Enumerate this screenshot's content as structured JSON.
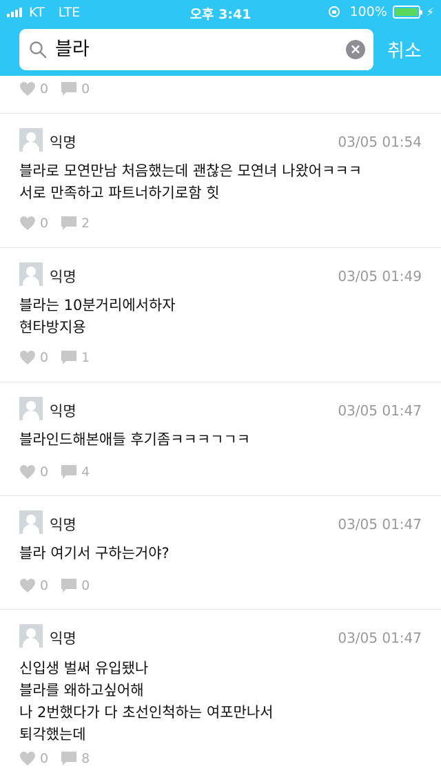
{
  "status_bar": {
    "carrier": "KT",
    "network": "LTE",
    "time": "오후 3:41",
    "battery": "100%",
    "battery_level": 1.0
  },
  "search": {
    "query": "블라",
    "cancel_label": "취소"
  },
  "icons": {
    "like": "heart-icon",
    "comment": "comment-bubble-icon",
    "search": "search-icon",
    "clear": "clear-icon"
  },
  "colors": {
    "header": "#2ec7f5",
    "meta_text": "#9a9a9a",
    "icon_gray": "#c8c8c8"
  },
  "top_partial": {
    "likes": "0",
    "comments": "0"
  },
  "posts": [
    {
      "author": "익명",
      "time": "03/05 01:54",
      "lines": [
        "블라로 모연만남 처음했는데 괜찮은 모연녀 나왔어ㅋㅋㅋ",
        "서로 만족하고 파트너하기로함 힛"
      ],
      "likes": "0",
      "comments": "2"
    },
    {
      "author": "익명",
      "time": "03/05 01:49",
      "lines": [
        "블라는 10분거리에서하자",
        "현타방지용"
      ],
      "likes": "0",
      "comments": "1"
    },
    {
      "author": "익명",
      "time": "03/05 01:47",
      "lines": [
        "블라인드해본애들 후기좀ㅋㅋㅋㄱㄱㅋ"
      ],
      "likes": "0",
      "comments": "4"
    },
    {
      "author": "익명",
      "time": "03/05 01:47",
      "lines": [
        "블라 여기서 구하는거야?"
      ],
      "likes": "0",
      "comments": "0"
    },
    {
      "author": "익명",
      "time": "03/05 01:47",
      "lines": [
        "신입생 벌써 유입됐나",
        "블라를 왜하고싶어해",
        "나 2번했다가 다 초선인척하는 여포만나서",
        "퇴각했는데"
      ],
      "likes": "0",
      "comments": "8"
    }
  ]
}
